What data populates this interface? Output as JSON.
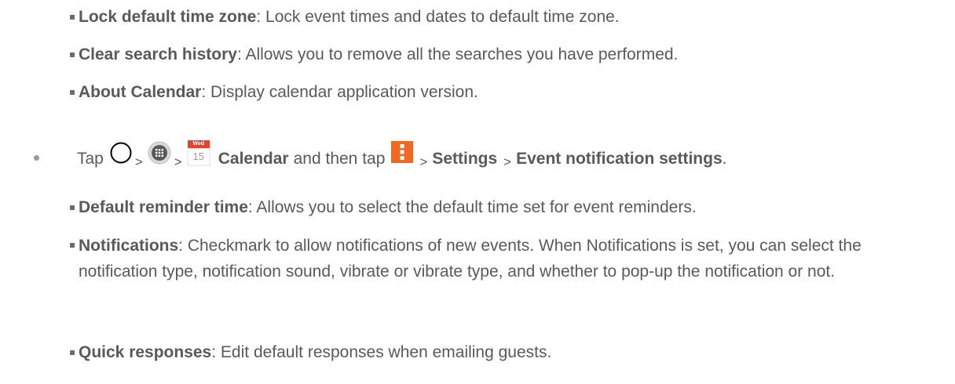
{
  "items_top": [
    {
      "term": "Lock default time zone",
      "desc": ": Lock event times and dates to default time zone."
    },
    {
      "term": "Clear search history",
      "desc": ": Allows you to remove all the searches you have performed."
    },
    {
      "term": "About Calendar",
      "desc": ": Display calendar application version."
    }
  ],
  "tap_line": {
    "tap": "Tap",
    "sep": ">",
    "calendar_icon_day": "Wed",
    "calendar_icon_date": "15",
    "calendar": "Calendar",
    "and_then": "and then tap",
    "settings": "Settings",
    "event_settings": "Event notification settings",
    "end": "."
  },
  "items_bottom": [
    {
      "term": "Default reminder time",
      "desc": ": Allows you to select the default time set for event reminders."
    },
    {
      "term": "Notifications",
      "desc": ": Checkmark to allow notifications of new events. When Notifications is set, you can select the notification type, notification sound, vibrate or vibrate type, and whether to pop-up the notification or not."
    },
    {
      "term": "Quick responses",
      "desc": ": Edit default responses when emailing guests."
    }
  ],
  "icons": [
    "home-circle-icon",
    "apps-grid-icon",
    "calendar-app-icon",
    "menu-more-icon"
  ],
  "colors": {
    "text": "#595959",
    "menu_icon": "#f26722",
    "calendar_header": "#e8412c"
  }
}
